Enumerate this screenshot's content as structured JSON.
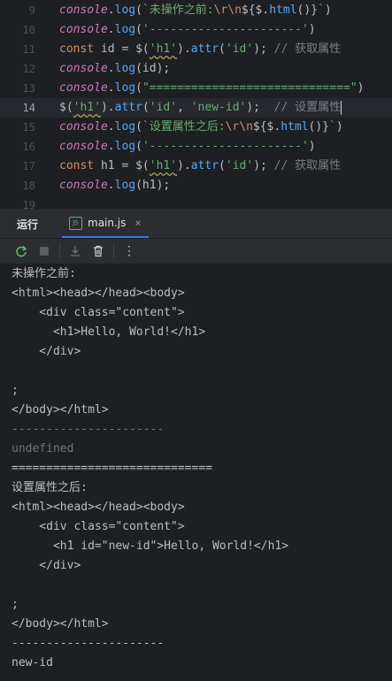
{
  "editor": {
    "lines": [
      {
        "num": "9",
        "parts": [
          [
            "obj",
            "console"
          ],
          [
            "plain",
            "."
          ],
          [
            "fn",
            "log"
          ],
          [
            "plain",
            "("
          ],
          [
            "str",
            "`未操作之前:"
          ],
          [
            "esc",
            "\\r\\n"
          ],
          [
            "plain",
            "${$."
          ],
          [
            "fn",
            "html"
          ],
          [
            "plain",
            "()}"
          ],
          [
            "str",
            "`"
          ],
          [
            "plain",
            ")"
          ]
        ]
      },
      {
        "num": "10",
        "parts": [
          [
            "obj",
            "console"
          ],
          [
            "plain",
            "."
          ],
          [
            "fn",
            "log"
          ],
          [
            "plain",
            "("
          ],
          [
            "str",
            "'----------------------'"
          ],
          [
            "plain",
            ")"
          ]
        ]
      },
      {
        "num": "11",
        "parts": [
          [
            "kw",
            "const "
          ],
          [
            "plain",
            "id = $("
          ],
          [
            "strw",
            "'h1'"
          ],
          [
            "plain",
            ")."
          ],
          [
            "fn",
            "attr"
          ],
          [
            "plain",
            "("
          ],
          [
            "str",
            "'id'"
          ],
          [
            "plain",
            "); "
          ],
          [
            "cmt",
            "// 获取属性"
          ]
        ]
      },
      {
        "num": "12",
        "parts": [
          [
            "obj",
            "console"
          ],
          [
            "plain",
            "."
          ],
          [
            "fn",
            "log"
          ],
          [
            "plain",
            "(id);"
          ]
        ]
      },
      {
        "num": "13",
        "parts": [
          [
            "obj",
            "console"
          ],
          [
            "plain",
            "."
          ],
          [
            "fn",
            "log"
          ],
          [
            "plain",
            "("
          ],
          [
            "str",
            "\"=============================\""
          ],
          [
            "plain",
            ")"
          ]
        ]
      },
      {
        "num": "14",
        "parts": [
          [
            "plain",
            "$("
          ],
          [
            "strw",
            "'h1'"
          ],
          [
            "plain",
            ")."
          ],
          [
            "fn",
            "attr"
          ],
          [
            "plain",
            "("
          ],
          [
            "str",
            "'id'"
          ],
          [
            "plain",
            ", "
          ],
          [
            "str",
            "'new-id'"
          ],
          [
            "plain",
            ");  "
          ],
          [
            "cmt",
            "// 设置属性"
          ]
        ],
        "current": true
      },
      {
        "num": "15",
        "parts": [
          [
            "obj",
            "console"
          ],
          [
            "plain",
            "."
          ],
          [
            "fn",
            "log"
          ],
          [
            "plain",
            "("
          ],
          [
            "str",
            "`设置属性之后:"
          ],
          [
            "esc",
            "\\r\\n"
          ],
          [
            "plain",
            "${$."
          ],
          [
            "fn",
            "html"
          ],
          [
            "plain",
            "()}"
          ],
          [
            "str",
            "`"
          ],
          [
            "plain",
            ")"
          ]
        ]
      },
      {
        "num": "16",
        "parts": [
          [
            "obj",
            "console"
          ],
          [
            "plain",
            "."
          ],
          [
            "fn",
            "log"
          ],
          [
            "plain",
            "("
          ],
          [
            "str",
            "'----------------------'"
          ],
          [
            "plain",
            ")"
          ]
        ]
      },
      {
        "num": "17",
        "parts": [
          [
            "kw",
            "const "
          ],
          [
            "plain",
            "h1 = $("
          ],
          [
            "strw",
            "'h1'"
          ],
          [
            "plain",
            ")."
          ],
          [
            "fn",
            "attr"
          ],
          [
            "plain",
            "("
          ],
          [
            "str",
            "'id'"
          ],
          [
            "plain",
            "); "
          ],
          [
            "cmt",
            "// 获取属性"
          ]
        ]
      },
      {
        "num": "18",
        "parts": [
          [
            "obj",
            "console"
          ],
          [
            "plain",
            "."
          ],
          [
            "fn",
            "log"
          ],
          [
            "plain",
            "(h1);"
          ]
        ]
      },
      {
        "num": "19",
        "parts": []
      }
    ]
  },
  "panel": {
    "run_label": "运行",
    "file_tab": "main.js",
    "file_icon_text": "JS",
    "close_glyph": "×"
  },
  "toolbar": {
    "icons": [
      "rerun-icon",
      "stop-icon",
      "scroll-to-end-icon",
      "clear-icon",
      "more-icon"
    ],
    "more_glyph": "⋮"
  },
  "console": {
    "lines": [
      {
        "text": "未操作之前:",
        "dim": false
      },
      {
        "text": "<html><head></head><body>",
        "dim": false
      },
      {
        "text": "    <div class=\"content\">",
        "dim": false
      },
      {
        "text": "      <h1>Hello, World!</h1>",
        "dim": false
      },
      {
        "text": "    </div>",
        "dim": false
      },
      {
        "text": "",
        "dim": false
      },
      {
        "text": ";",
        "dim": false
      },
      {
        "text": "</body></html>",
        "dim": false
      },
      {
        "text": "----------------------",
        "dim": true
      },
      {
        "text": "undefined",
        "dim": true
      },
      {
        "text": "=============================",
        "dim": false
      },
      {
        "text": "设置属性之后:",
        "dim": false
      },
      {
        "text": "<html><head></head><body>",
        "dim": false
      },
      {
        "text": "    <div class=\"content\">",
        "dim": false
      },
      {
        "text": "      <h1 id=\"new-id\">Hello, World!</h1>",
        "dim": false
      },
      {
        "text": "    </div>",
        "dim": false
      },
      {
        "text": "",
        "dim": false
      },
      {
        "text": ";",
        "dim": false
      },
      {
        "text": "</body></html>",
        "dim": false
      },
      {
        "text": "----------------------",
        "dim": false
      },
      {
        "text": "new-id",
        "dim": false
      }
    ]
  },
  "colors": {
    "background": "#1e1f22",
    "panel": "#2b2d30",
    "accent": "#3574f0",
    "rerun_green": "#5fb865"
  }
}
